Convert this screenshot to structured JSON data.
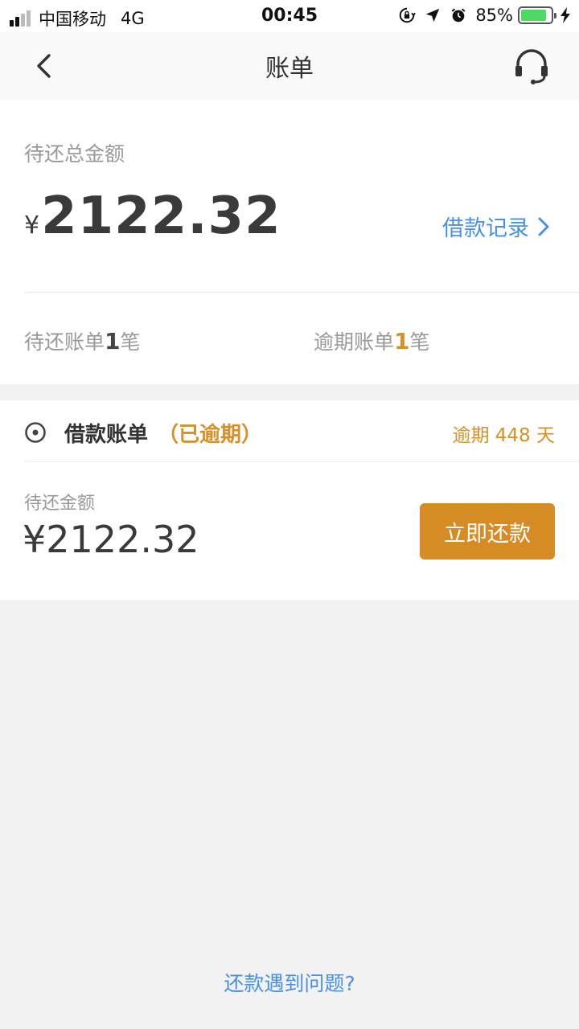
{
  "status_bar": {
    "carrier": "中国移动",
    "network": "4G",
    "time": "00:45",
    "battery_percent": "85%",
    "battery_level": 0.85
  },
  "nav": {
    "title": "账单",
    "back_icon": "chevron-left-icon",
    "service_icon": "headset-icon"
  },
  "summary": {
    "label": "待还总金额",
    "currency": "¥",
    "amount": "2122.32",
    "loan_record_label": "借款记录",
    "pending_prefix": "待还账单",
    "pending_count": "1",
    "pending_suffix": "笔",
    "overdue_prefix": "逾期账单",
    "overdue_count": "1",
    "overdue_suffix": "笔"
  },
  "bill": {
    "title": "借款账单",
    "tag": "（已逾期）",
    "overdue_text": "逾期 448 天",
    "amount_label": "待还金额",
    "amount": "¥2122.32",
    "repay_button": "立即还款"
  },
  "footer": {
    "help_link": "还款遇到问题?"
  },
  "colors": {
    "accent_blue": "#4a90e2",
    "accent_orange": "#d68b24",
    "battery_green": "#4cd964"
  }
}
